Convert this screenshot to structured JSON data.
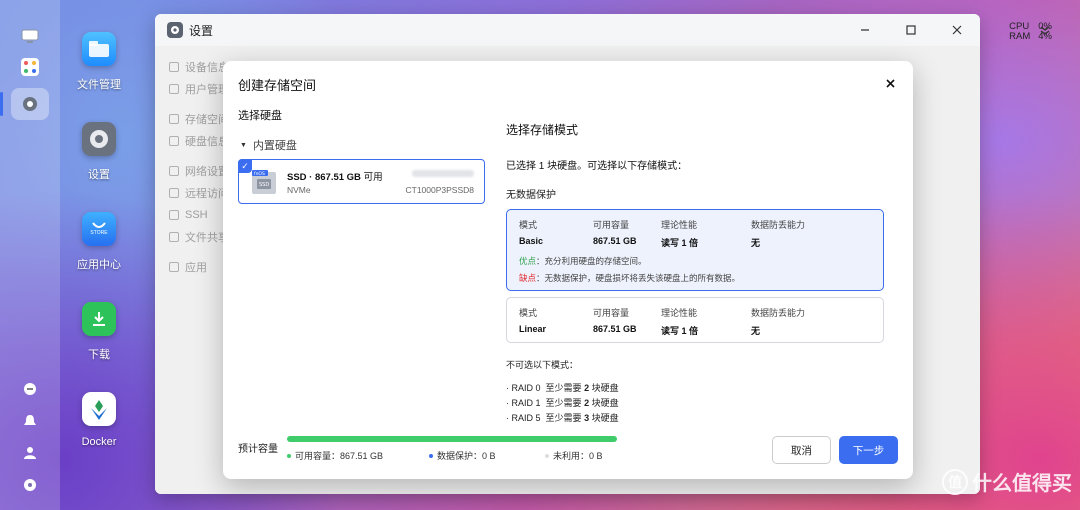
{
  "desktop": {
    "icons": [
      {
        "label": "文件管理",
        "icon": "folder-icon"
      },
      {
        "label": "设置",
        "icon": "gear-icon"
      },
      {
        "label": "应用中心",
        "icon": "store-icon"
      },
      {
        "label": "下载",
        "icon": "download-icon"
      },
      {
        "label": "Docker",
        "icon": "docker-icon"
      }
    ],
    "store_badge": "STORE"
  },
  "status": {
    "cpu_label": "CPU",
    "cpu_value": "0%",
    "ram_label": "RAM",
    "ram_value": "4%"
  },
  "window": {
    "title": "设置",
    "sidebar": [
      {
        "label": "设备信息"
      },
      {
        "label": "用户管理"
      },
      {
        "label": "存储空间"
      },
      {
        "label": "硬盘信息"
      },
      {
        "label": "网络设置"
      },
      {
        "label": "远程访问"
      },
      {
        "label": "SSH"
      },
      {
        "label": "文件共享"
      },
      {
        "label": "应用"
      }
    ]
  },
  "modal": {
    "title": "创建存储空间",
    "select_disk_title": "选择硬盘",
    "group_label": "内置硬盘",
    "disk": {
      "badge": "fnOS",
      "name_prefix": "SSD · 867.51 GB",
      "name_suffix": "可用",
      "type": "NVMe",
      "model": "CT1000P3PSSD8"
    },
    "mode_title": "选择存储模式",
    "selected_info": "已选择 1 块硬盘。可选择以下存储模式：",
    "no_protection": "无数据保护",
    "columns": [
      "模式",
      "可用容量",
      "理论性能",
      "数据防丢能力"
    ],
    "modes": [
      {
        "name": "Basic",
        "capacity": "867.51 GB",
        "performance": "读写 1 倍",
        "protection": "无",
        "pro_key": "优点",
        "pro": "：充分利用硬盘的存储空间。",
        "con_key": "缺点",
        "con": "：无数据保护，硬盘损坏将丢失该硬盘上的所有数据。"
      },
      {
        "name": "Linear",
        "capacity": "867.51 GB",
        "performance": "读写 1 倍",
        "protection": "无"
      }
    ],
    "unavailable_title": "不可选以下模式：",
    "unavailable": [
      {
        "name": "· RAID 0",
        "req_prefix": "至少需要",
        "count": "2",
        "req_suffix": "块硬盘"
      },
      {
        "name": "· RAID 1",
        "req_prefix": "至少需要",
        "count": "2",
        "req_suffix": "块硬盘"
      },
      {
        "name": "· RAID 5",
        "req_prefix": "至少需要",
        "count": "3",
        "req_suffix": "块硬盘"
      }
    ],
    "footer": {
      "estimate_label": "预计容量",
      "usage_fraction": 1.0,
      "legend": [
        {
          "label": "可用容量：867.51 GB",
          "color": "#3fcc6b"
        },
        {
          "label": "数据保护：0 B",
          "color": "#3b6df0"
        },
        {
          "label": "未利用：0 B",
          "color": "#dddddd"
        }
      ],
      "cancel": "取消",
      "next": "下一步"
    }
  },
  "watermark": {
    "mark": "值",
    "text": "什么值得买"
  }
}
